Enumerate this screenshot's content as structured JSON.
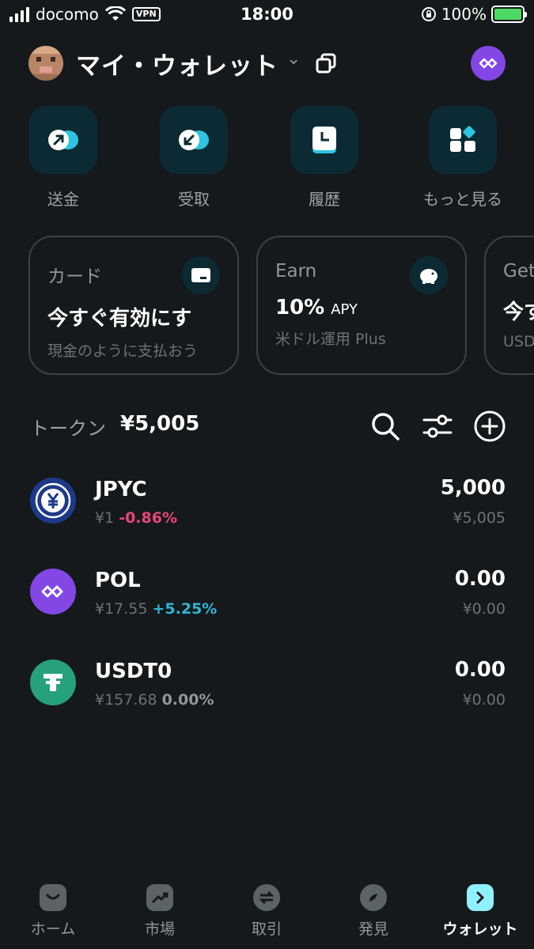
{
  "status_bar": {
    "carrier": "docomo",
    "vpn": "VPN",
    "time": "18:00",
    "battery": "100%"
  },
  "header": {
    "wallet_name": "マイ・ウォレット"
  },
  "actions": [
    {
      "label": "送金",
      "icon": "send-arrow-icon"
    },
    {
      "label": "受取",
      "icon": "receive-arrow-icon"
    },
    {
      "label": "履歴",
      "icon": "history-icon"
    },
    {
      "label": "もっと見る",
      "icon": "more-grid-icon"
    }
  ],
  "cards": [
    {
      "title": "カード",
      "main": "今すぐ有効にす",
      "sub": "現金のように支払おう",
      "icon": "card-icon"
    },
    {
      "title": "Earn",
      "main": "10%",
      "main_suffix": "APY",
      "sub": "米ドル運用 Plus",
      "icon": "piggy-bank-icon"
    },
    {
      "title": "Get",
      "main": "今す",
      "sub": "USD"
    }
  ],
  "tokens_header": {
    "label": "トークン",
    "total": "¥5,005"
  },
  "tokens": [
    {
      "name": "JPYC",
      "price": "¥1",
      "change": "-0.86%",
      "amount": "5,000",
      "value": "¥5,005",
      "trend": "negative",
      "logo_color": "#1d3a8a"
    },
    {
      "name": "POL",
      "price": "¥17.55",
      "change": "+5.25%",
      "amount": "0.00",
      "value": "¥0.00",
      "trend": "positive",
      "logo_color": "#8247e5"
    },
    {
      "name": "USDT0",
      "price": "¥157.68",
      "change": "0.00%",
      "amount": "0.00",
      "value": "¥0.00",
      "trend": "flat",
      "logo_color": "#26a17b"
    }
  ],
  "bottom_nav": [
    {
      "label": "ホーム",
      "icon": "home-icon"
    },
    {
      "label": "市場",
      "icon": "market-chart-icon"
    },
    {
      "label": "取引",
      "icon": "swap-icon"
    },
    {
      "label": "発見",
      "icon": "discover-icon"
    },
    {
      "label": "ウォレット",
      "icon": "wallet-icon",
      "active": true
    }
  ],
  "colors": {
    "background": "#15191b",
    "accent": "#8ff0ff",
    "negative": "#e9457a",
    "positive": "#2fb6d6"
  }
}
